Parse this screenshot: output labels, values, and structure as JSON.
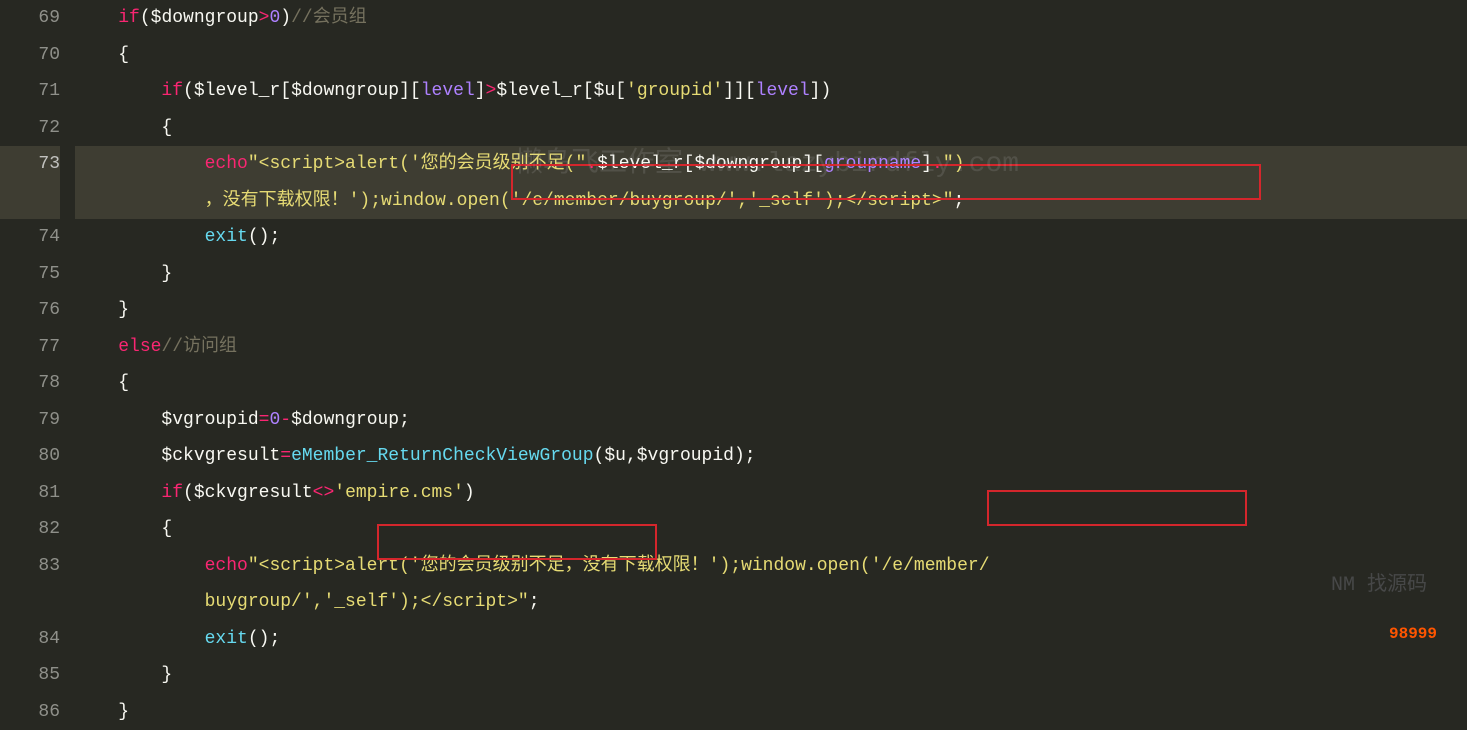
{
  "gutter": {
    "start": 69,
    "end": 86,
    "current": 73
  },
  "tokens": {
    "if": "if",
    "else": "else",
    "echo": "echo",
    "exit": "exit",
    "downgroup": "$downgroup",
    "level_r": "$level_r",
    "u": "$u",
    "vgroupid": "$vgroupid",
    "ckvgresult": "$ckvgresult",
    "level": "level",
    "groupid_str": "'groupid'",
    "groupname": "groupname",
    "empire_cms": "'empire.cms'",
    "zero": "0",
    "emember_fn": "eMember_ReturnCheckViewGroup",
    "cmt_member": "//会员组",
    "cmt_visit": "//访问组",
    "str_script_open": "\"<script>alert('您的会员级别不足(\"",
    "str_nodown": "\")\n，没有下载权限！');window.open('/e/member/buygroup/','_self');</script>\"",
    "str_line73a": "\"<script>alert('您的会员级别不足(\"",
    "str_line73b": "\")",
    "str_wrap73": "，没有下载权限！');window.open('/e/member/buygroup/','_self');</script>\"",
    "str_line83a": "\"<script>alert('您的会员级别不足，没有下载权限！');window.open('/e/member/",
    "str_line83b": "buygroup/','_self');</script>\""
  },
  "watermarks": {
    "main": "懒鸟飞工作室\nwww.lazybirdfly.com",
    "side": "NM 找源码",
    "bottom": "98999"
  }
}
